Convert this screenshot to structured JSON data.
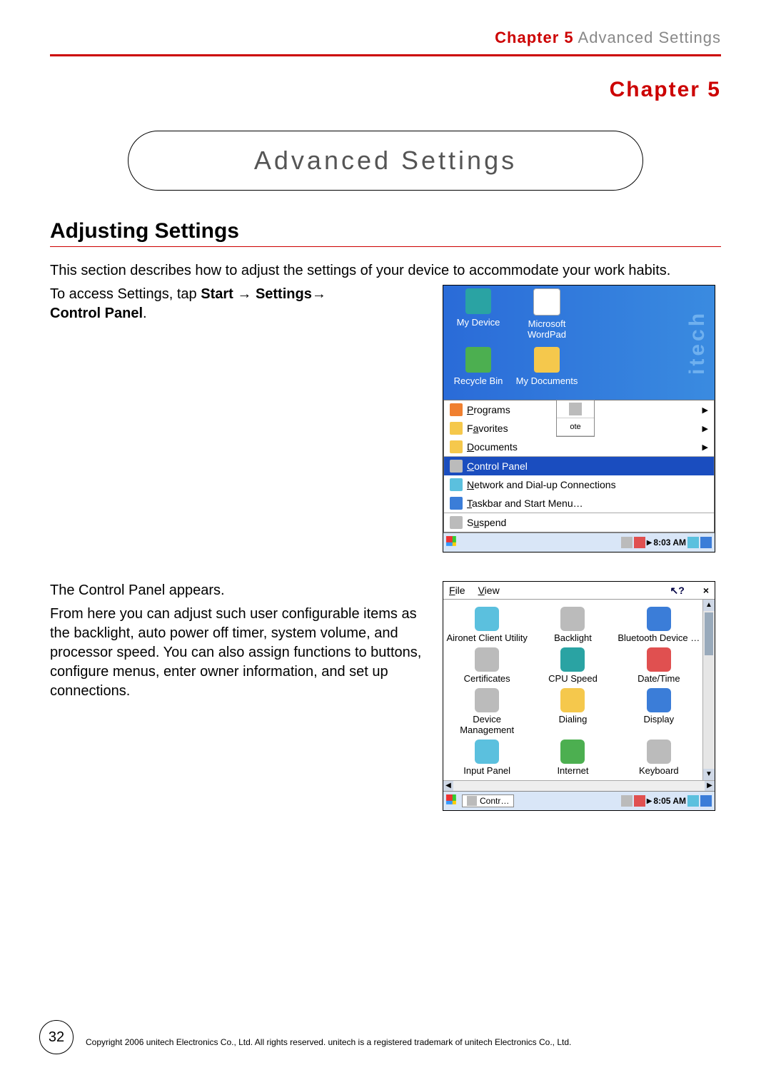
{
  "header": {
    "chapter_red": "Chapter 5",
    "chapter_grey": " Advanced Settings"
  },
  "chapter_label": "Chapter 5",
  "title_bubble": "Advanced Settings",
  "section_title": "Adjusting Settings",
  "intro": "This section describes how to adjust the settings of your device to accommodate your work habits.",
  "access_line_pre": "To access Settings, tap ",
  "access_start": "Start",
  "access_arrow1": " → ",
  "access_settings": "Settings",
  "access_arrow2": "→",
  "access_cp": "Control Panel",
  "access_period": ".",
  "wallmark": "itech",
  "desktop_icons": {
    "my_device": "My Device",
    "wordpad": "Microsoft WordPad",
    "recycle": "Recycle Bin",
    "my_docs": "My Documents"
  },
  "start_menu": {
    "programs": "Programs",
    "favorites": "Favorites",
    "documents": "Documents",
    "settings_sub": {
      "control_panel": "Control Panel",
      "network": "Network and Dial-up Connections",
      "taskbar": "Taskbar and Start Menu…"
    },
    "suspend": "Suspend"
  },
  "flyout": {
    "item1": "",
    "item2": "ote"
  },
  "taskbar1_time": "8:03 AM",
  "cp_appears": "The Control Panel appears.",
  "cp_desc": "From here you can adjust such user configurable items as the backlight, auto power off timer, system volume, and processor speed. You can also assign functions to buttons, configure menus, enter owner information, and set up connections.",
  "cp_menu": {
    "file": "File",
    "view": "View",
    "help": "?",
    "close": "×"
  },
  "cp_items": [
    "Aironet Client Utility",
    "Backlight",
    "Bluetooth Device …",
    "Certificates",
    "CPU Speed",
    "Date/Time",
    "Device Management",
    "Dialing",
    "Display",
    "Input Panel",
    "Internet",
    "Keyboard"
  ],
  "taskbar2_task": "Contr…",
  "taskbar2_time": "8:05 AM",
  "page_number": "32",
  "copyright": "Copyright 2006 unitech Electronics Co., Ltd. All rights reserved. unitech is a registered trademark of unitech Electronics Co., Ltd."
}
